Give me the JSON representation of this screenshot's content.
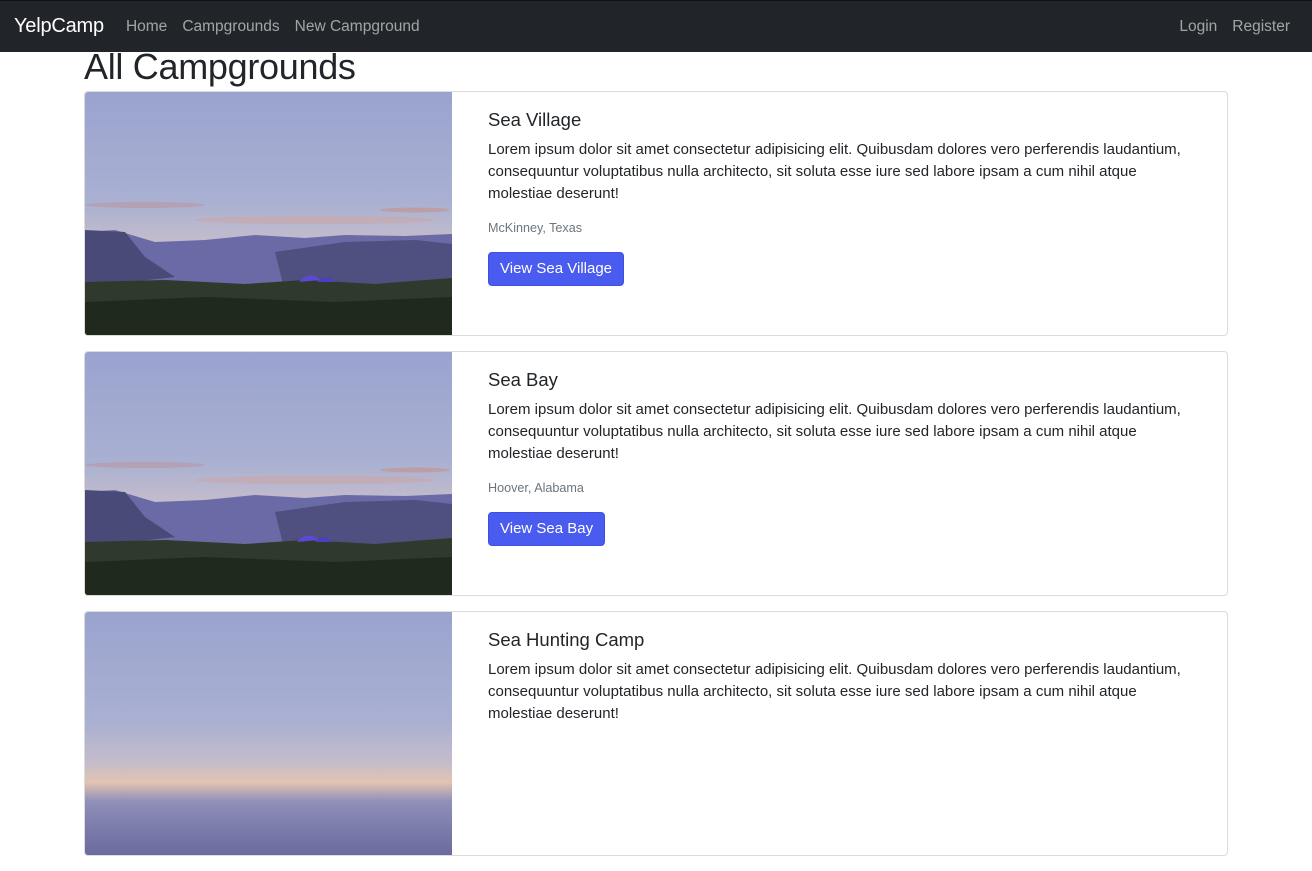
{
  "navbar": {
    "brand": "YelpCamp",
    "links": [
      "Home",
      "Campgrounds",
      "New Campground"
    ],
    "right_links": [
      "Login",
      "Register"
    ]
  },
  "page": {
    "title": "All Campgrounds"
  },
  "campgrounds": [
    {
      "title": "Sea Village",
      "description": "Lorem ipsum dolor sit amet consectetur adipisicing elit. Quibusdam dolores vero perferendis laudantium, consequuntur voluptatibus nulla architecto, sit soluta esse iure sed labore ipsam a cum nihil atque molestiae deserunt!",
      "location": "McKinney, Texas",
      "button": "View Sea Village"
    },
    {
      "title": "Sea Bay",
      "description": "Lorem ipsum dolor sit amet consectetur adipisicing elit. Quibusdam dolores vero perferendis laudantium, consequuntur voluptatibus nulla architecto, sit soluta esse iure sed labore ipsam a cum nihil atque molestiae deserunt!",
      "location": "Hoover, Alabama",
      "button": "View Sea Bay"
    },
    {
      "title": "Sea Hunting Camp",
      "description": "Lorem ipsum dolor sit amet consectetur adipisicing elit. Quibusdam dolores vero perferendis laudantium, consequuntur voluptatibus nulla architecto, sit soluta esse iure sed labore ipsam a cum nihil atque molestiae deserunt!",
      "location": "",
      "button": ""
    }
  ],
  "colors": {
    "navbar": "#212529",
    "button": "#4a5cf0",
    "muted": "#6c757d"
  }
}
